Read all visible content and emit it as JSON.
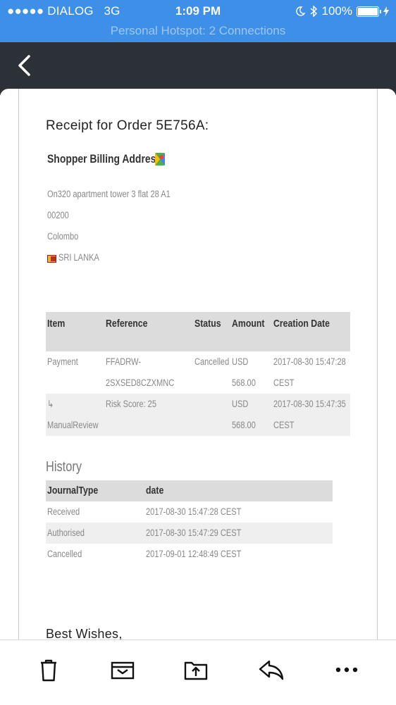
{
  "status_bar": {
    "carrier": "●●●●● DIALOG",
    "network": "3G",
    "time": "1:09 PM",
    "battery": "100%",
    "hotspot": "Personal Hotspot: 2 Connections"
  },
  "email": {
    "receipt_title": "Receipt for Order 5E756A:",
    "address_heading": "Shopper Billing Address",
    "address_lines": [
      "On320 apartment tower 3 flat 28 A1",
      "00200",
      "Colombo",
      "SRI LANKA"
    ],
    "items_table": {
      "headers": [
        "Item",
        "Reference",
        "Status",
        "Amount",
        "Creation Date"
      ],
      "rows": [
        {
          "item": "Payment",
          "reference": [
            "FFADRW-",
            "2SXSED8CZXMNC"
          ],
          "status": "Cancelled",
          "amount": [
            "USD",
            "568.00"
          ],
          "date": [
            "2017-08-30 15:47:28",
            "CEST"
          ]
        },
        {
          "item": [
            "↳",
            "ManualReview"
          ],
          "reference": "Risk Score: 25",
          "status": "",
          "amount": [
            "USD",
            "568.00"
          ],
          "date": [
            "2017-08-30 15:47:35",
            "CEST"
          ]
        }
      ]
    },
    "history_title": "History",
    "history_table": {
      "headers": [
        "JournalType",
        "date"
      ],
      "rows": [
        [
          "Received",
          "2017-08-30 15:47:28 CEST"
        ],
        [
          "Authorised",
          "2017-08-30 15:47:29 CEST"
        ],
        [
          "Cancelled",
          "2017-09-01 12:48:49 CEST"
        ]
      ]
    },
    "closing": "Best Wishes,"
  },
  "toolbar": {
    "icons": [
      "trash-icon",
      "archive-icon",
      "move-icon",
      "reply-icon",
      "more-icon"
    ]
  }
}
